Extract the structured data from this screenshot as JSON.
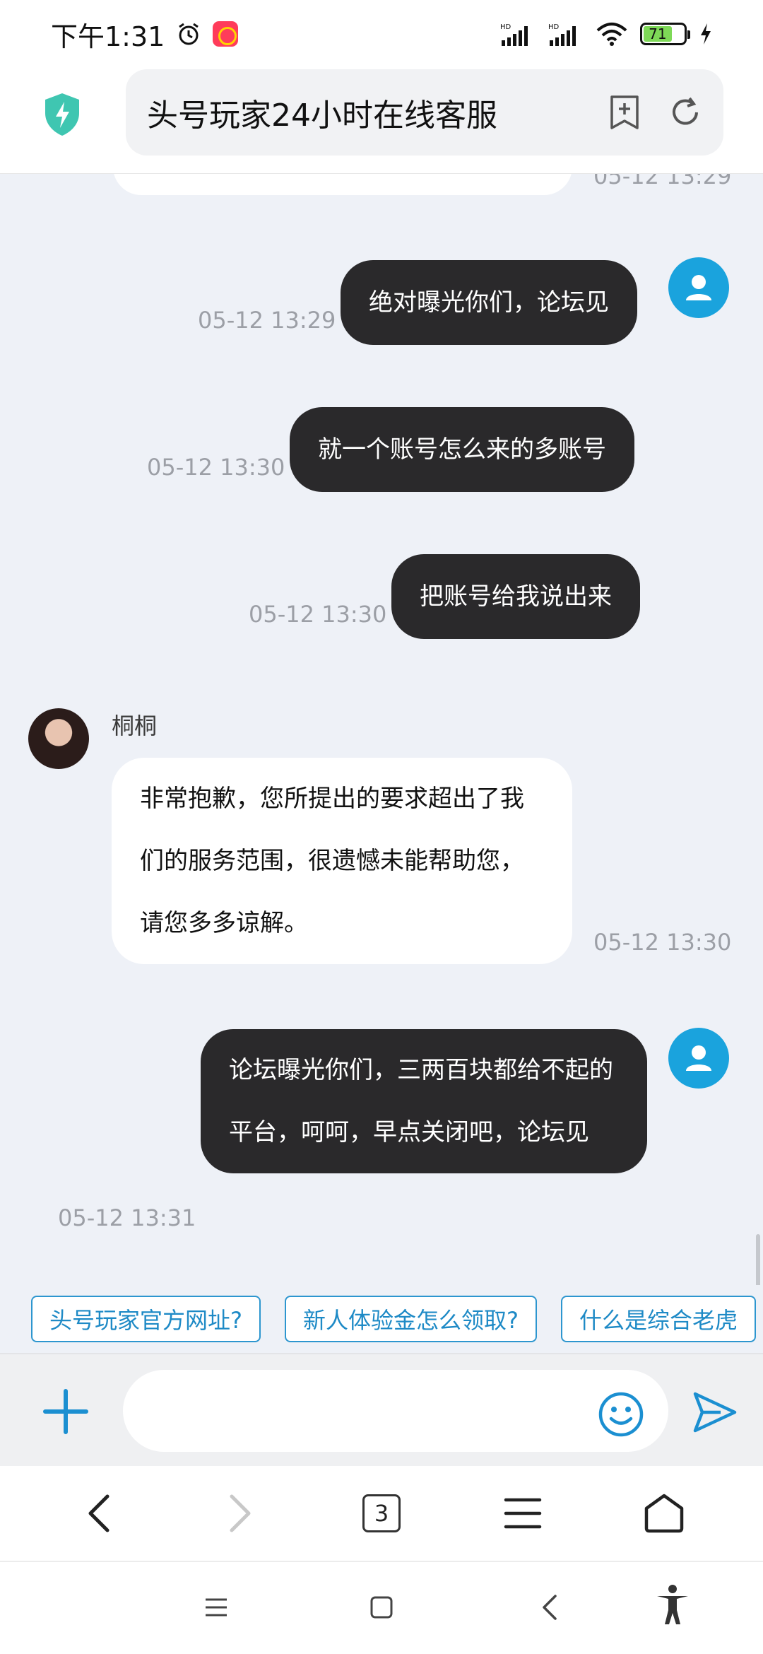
{
  "status_bar": {
    "time": "下午1:31",
    "battery": "71"
  },
  "header": {
    "title": "头号玩家24小时在线客服"
  },
  "chat": {
    "top_partial_timestamp": "05-12 13:29",
    "messages": [
      {
        "sender": "user",
        "text": "绝对曝光你们，论坛见",
        "time": "05-12 13:29"
      },
      {
        "sender": "user",
        "text": "就一个账号怎么来的多账号",
        "time": "05-12 13:30"
      },
      {
        "sender": "user",
        "text": "把账号给我说出来",
        "time": "05-12 13:30"
      },
      {
        "sender": "agent",
        "name": "桐桐",
        "text": "非常抱歉，您所提出的要求超出了我们的服务范围，很遗憾未能帮助您，请您多多谅解。",
        "time": "05-12 13:30"
      },
      {
        "sender": "user",
        "text": "论坛曝光你们，三两百块都给不起的平台，呵呵，早点关闭吧，论坛见",
        "time": "05-12 13:31"
      }
    ]
  },
  "quick_replies": [
    "头号玩家官方网址?",
    "新人体验金怎么领取?",
    "什么是综合老虎"
  ],
  "input": {
    "placeholder": ""
  },
  "browser_nav": {
    "tab_count": "3"
  },
  "colors": {
    "accent": "#1aa3dd",
    "user_bubble": "#2a292b",
    "background": "#eef1f7"
  }
}
